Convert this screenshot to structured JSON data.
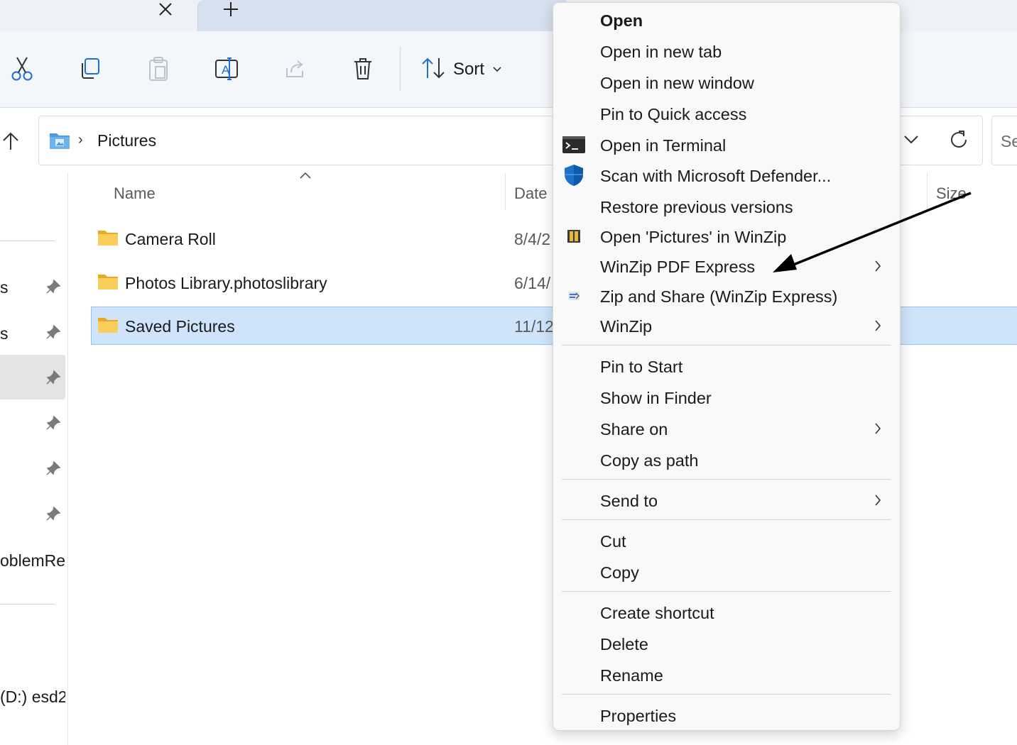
{
  "tabs": {
    "close_glyph": "✕",
    "new_tab_glyph": "+"
  },
  "toolbar": {
    "cut_icon": "scissors-icon",
    "copy_icon": "copy-icon",
    "paste_icon": "paste-icon",
    "rename_icon": "rename-icon",
    "share_icon": "share-icon",
    "delete_icon": "trash-icon",
    "sort_label": "Sort"
  },
  "address": {
    "chevron": "›",
    "path": "Pictures",
    "search_placeholder": "Se"
  },
  "nav_pane": {
    "fragments": [
      "s",
      "s",
      "oblemRep",
      "(D:) esd2"
    ]
  },
  "columns": {
    "name": "Name",
    "date": "Date",
    "size": "Size"
  },
  "files": [
    {
      "name": "Camera Roll",
      "date": "8/4/2"
    },
    {
      "name": "Photos Library.photoslibrary",
      "date": "6/14/"
    },
    {
      "name": "Saved Pictures",
      "date": "11/12",
      "selected": true
    }
  ],
  "context_menu": {
    "groups": [
      [
        "Open",
        "Open in new tab",
        "Open in new window",
        "Pin to Quick access",
        "Open in Terminal",
        "Scan with Microsoft Defender...",
        "Restore previous versions",
        "Open 'Pictures' in WinZip",
        "WinZip PDF Express",
        "Zip and Share (WinZip Express)",
        "WinZip"
      ],
      [
        "Pin to Start",
        "Show in Finder",
        "Share on",
        "Copy as path"
      ],
      [
        "Send to"
      ],
      [
        "Cut",
        "Copy"
      ],
      [
        "Create shortcut",
        "Delete",
        "Rename"
      ],
      [
        "Properties"
      ]
    ],
    "items": {
      "open": "Open",
      "open_new_tab": "Open in new tab",
      "open_new_window": "Open in new window",
      "pin_quick_access": "Pin to Quick access",
      "open_terminal": "Open in Terminal",
      "scan_defender": "Scan with Microsoft Defender...",
      "restore_versions": "Restore previous versions",
      "open_winzip": "Open 'Pictures' in WinZip",
      "winzip_pdf": "WinZip PDF Express",
      "zip_share": "Zip and Share (WinZip Express)",
      "winzip": "WinZip",
      "pin_start": "Pin to Start",
      "show_finder": "Show in Finder",
      "share_on": "Share on",
      "copy_path": "Copy as path",
      "send_to": "Send to",
      "cut": "Cut",
      "copy": "Copy",
      "create_shortcut": "Create shortcut",
      "delete": "Delete",
      "rename": "Rename",
      "properties": "Properties"
    },
    "submenu_items": [
      "WinZip PDF Express",
      "WinZip",
      "Share on",
      "Send to"
    ]
  },
  "colors": {
    "selected_row": "#cfe4fb",
    "folder": "#f5c542",
    "defender_blue": "#1a73c8",
    "toolbar_bg": "#f3f6fb",
    "menu_bg": "#f9f9f9"
  }
}
